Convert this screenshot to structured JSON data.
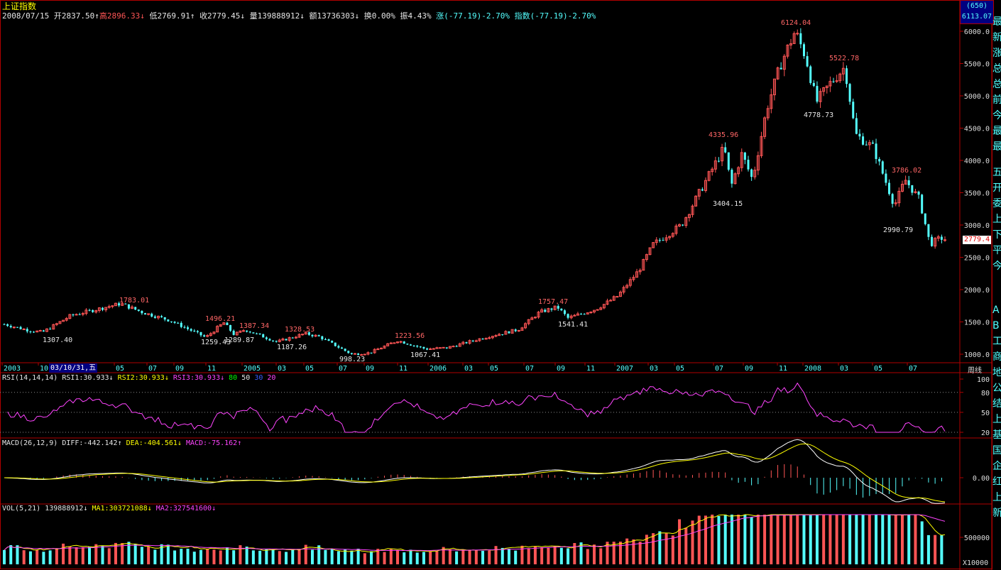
{
  "window": {
    "title": "上证指数",
    "corner_code": "(650)",
    "corner_value": "6113.07"
  },
  "quote": {
    "date": "2008/07/15",
    "open": "开2837.50↑",
    "high": "高2896.33↓",
    "low": "低2769.91↑",
    "close": "收2779.45↓",
    "vol": "量139888912↓",
    "amount": "额13736303↓",
    "turnover": "换0.00%",
    "amplitude": "振4.43%",
    "change": "涨(-77.19)-2.70%",
    "index_change": "指数(-77.19)-2.70%"
  },
  "price_axis": {
    "labels": [
      "6000.0",
      "5500.0",
      "5000.0",
      "4500.0",
      "4000.0",
      "3500.0",
      "3000.0",
      "2500.0",
      "2000.0",
      "1500.0",
      "1000.0"
    ],
    "current": "2779.4"
  },
  "annotations": {
    "highs": [
      "1783.01",
      "1496.21",
      "1387.34",
      "1328.53",
      "1223.56",
      "1757.47",
      "4335.96",
      "6124.04",
      "5522.78",
      "3786.02"
    ],
    "lows": [
      "1307.40",
      "1259.43",
      "1289.87",
      "1187.26",
      "998.23",
      "1067.41",
      "1541.41",
      "3404.15",
      "4778.73",
      "2990.79"
    ]
  },
  "time_axis": {
    "labels": [
      "2003",
      "10",
      "03",
      "05",
      "07",
      "09",
      "11",
      "2005",
      "03",
      "05",
      "07",
      "09",
      "11",
      "2006",
      "03",
      "05",
      "07",
      "09",
      "11",
      "2007",
      "03",
      "05",
      "07",
      "09",
      "11",
      "2008",
      "03",
      "05",
      "07"
    ],
    "cursor": "03/10/31,五",
    "period": "周线"
  },
  "rsi": {
    "label": "RSI(14,14,14)",
    "rsi1": "RSI1:30.933↓",
    "rsi2": "RSI2:30.933↓",
    "rsi3": "RSI3:30.933↓",
    "lv80": "80",
    "lv50": "50",
    "lv30": "30",
    "lv20": "20",
    "axis": [
      "100",
      "80",
      "50",
      "20"
    ]
  },
  "macd": {
    "label": "MACD(26,12,9)",
    "diff": "DIFF:-442.142↑",
    "dea": "DEA:-404.561↓",
    "macd": "MACD:-75.162↑",
    "axis": "0.00"
  },
  "vol": {
    "label": "VOL(5,21)",
    "value": "139888912↓",
    "ma1": "MA1:303721088↓",
    "ma2": "MA2:327541600↓",
    "axis": "500000",
    "unit": "X10000"
  },
  "side_panel": {
    "text1": "最新涨总总前今最最",
    "text2": "五开委上下平今",
    "text3": "AB工商地公结上基国企红上新"
  },
  "colors": {
    "up": "#ff5555",
    "down": "#54ffff",
    "frame": "#b00000",
    "rsi": "#ff44ff",
    "diff": "#ffffff",
    "dea": "#ffff00",
    "ma1": "#ffff00",
    "ma2": "#ff44ff"
  },
  "chart_data": {
    "type": "candlestick",
    "index_name": "上证指数",
    "period": "周线",
    "ylim": [
      900,
      6300
    ],
    "swing_points": [
      {
        "label": "1307.40",
        "value": 1307.4,
        "kind": "low"
      },
      {
        "label": "1783.01",
        "value": 1783.01,
        "kind": "high"
      },
      {
        "label": "1259.43",
        "value": 1259.43,
        "kind": "low"
      },
      {
        "label": "1496.21",
        "value": 1496.21,
        "kind": "high"
      },
      {
        "label": "1289.87",
        "value": 1289.87,
        "kind": "low"
      },
      {
        "label": "1387.34",
        "value": 1387.34,
        "kind": "high"
      },
      {
        "label": "1187.26",
        "value": 1187.26,
        "kind": "low"
      },
      {
        "label": "1328.53",
        "value": 1328.53,
        "kind": "high"
      },
      {
        "label": "998.23",
        "value": 998.23,
        "kind": "low"
      },
      {
        "label": "1223.56",
        "value": 1223.56,
        "kind": "high"
      },
      {
        "label": "1067.41",
        "value": 1067.41,
        "kind": "low"
      },
      {
        "label": "1757.47",
        "value": 1757.47,
        "kind": "high"
      },
      {
        "label": "1541.41",
        "value": 1541.41,
        "kind": "low"
      },
      {
        "label": "4335.96",
        "value": 4335.96,
        "kind": "high"
      },
      {
        "label": "3404.15",
        "value": 3404.15,
        "kind": "low"
      },
      {
        "label": "6124.04",
        "value": 6124.04,
        "kind": "high"
      },
      {
        "label": "4778.73",
        "value": 4778.73,
        "kind": "low"
      },
      {
        "label": "5522.78",
        "value": 5522.78,
        "kind": "high"
      },
      {
        "label": "3786.02",
        "value": 3786.02,
        "kind": "high"
      },
      {
        "label": "2990.79",
        "value": 2990.79,
        "kind": "low"
      }
    ],
    "last_close": 2779.45
  }
}
